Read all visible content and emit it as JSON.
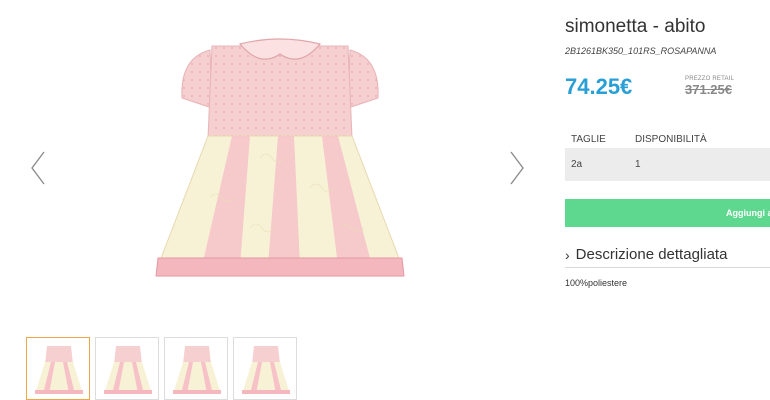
{
  "product": {
    "title": "simonetta - abito",
    "sku": "2B1261BK350_101RS_ROSAPANNA",
    "price": "74.25€",
    "retail_label": "PREZZO RETAIL",
    "retail_price": "371.25€"
  },
  "sizes": {
    "header_size": "TAGLIE",
    "header_availability": "DISPONIBILITÀ",
    "rows": [
      {
        "size": "2a",
        "availability": "1"
      }
    ]
  },
  "actions": {
    "add_to_cart": "Aggiungi al carrello"
  },
  "description": {
    "toggle_label": "Descrizione dettagliata",
    "text": "100%poliestere"
  },
  "gallery": {
    "thumbnail_count": 4,
    "active_index": 0
  },
  "colors": {
    "price": "#2a9fd6",
    "cart_button": "#5fd88f",
    "active_thumb_border": "#f0a64a",
    "dress_pink": "#f6c9cc",
    "dress_cream": "#f7f1d6"
  },
  "icons": {
    "prev": "chevron-left-icon",
    "next": "chevron-right-icon",
    "toggle": "chevron-right-icon"
  }
}
